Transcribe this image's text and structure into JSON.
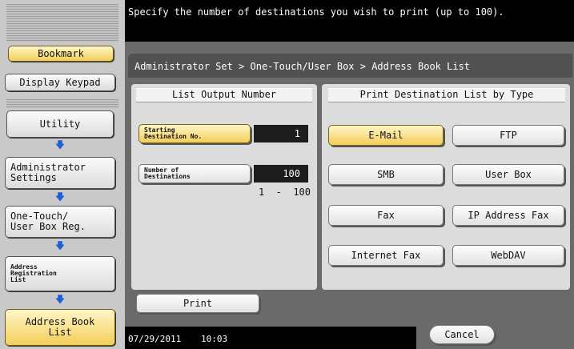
{
  "top_message": "Specify the number of destinations you wish to print (up to 100).",
  "sidebar": {
    "bookmark": "Bookmark",
    "display_keypad": "Display Keypad",
    "utility": "Utility",
    "admin_settings": "Administrator\nSettings",
    "one_touch": "One-Touch/\nUser Box Reg.",
    "address_registration": "Address\nRegistration\nList",
    "address_book_list": "Address Book\nList"
  },
  "breadcrumb": "Administrator Set > One-Touch/User Box > Address Book List",
  "list_output": {
    "header": "List Output Number",
    "starting_label": "Starting\nDestination No.",
    "starting_value": "1",
    "number_label": "Number of\nDestinations",
    "number_value": "100",
    "range": "1  -  100"
  },
  "print_by_type": {
    "header": "Print Destination List by Type",
    "buttons": [
      "E-Mail",
      "FTP",
      "SMB",
      "User Box",
      "Fax",
      "IP Address Fax",
      "Internet Fax",
      "WebDAV"
    ]
  },
  "print_button": "Print",
  "footer": {
    "date": "07/29/2011",
    "time": "10:03",
    "cancel": "Cancel"
  },
  "colors": {
    "selected": "#f3cf58",
    "arrow": "#1e5fd6"
  }
}
